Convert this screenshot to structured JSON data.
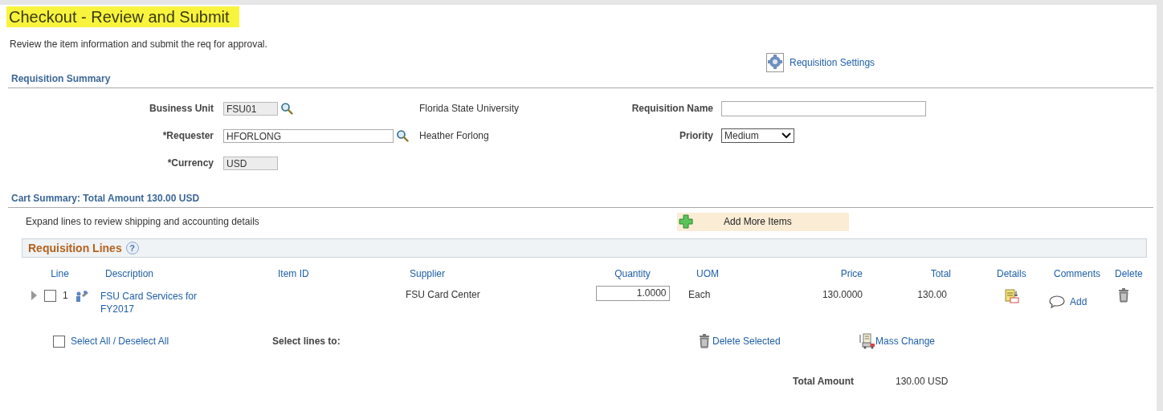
{
  "page": {
    "title": "Checkout - Review and Submit",
    "instructions": "Review the item information and submit the req for approval.",
    "settings_link": "Requisition Settings"
  },
  "requisition_summary": {
    "heading": "Requisition Summary",
    "fields": [
      {
        "label": "Business Unit",
        "kind": "lookup",
        "value": "FSU01",
        "disabled": true,
        "description": "Florida State University"
      },
      {
        "label": "*Requester",
        "kind": "lookup",
        "value": "HFORLONG",
        "disabled": false,
        "description": "Heather Forlong"
      },
      {
        "label": "*Currency",
        "kind": "text",
        "value": "USD",
        "disabled": true
      }
    ],
    "side_fields": [
      {
        "label": "Requisition Name",
        "kind": "text"
      },
      {
        "label": "Priority",
        "kind": "select",
        "value": "Medium"
      }
    ]
  },
  "cart_summary": {
    "heading": "Cart Summary: Total Amount 130.00 USD",
    "hint": "Expand lines to review shipping and accounting details",
    "add_button": "Add More Items"
  },
  "requisition_lines": {
    "title": "Requisition Lines",
    "help": "?",
    "columns": [
      "Line",
      "Description",
      "Item ID",
      "Supplier",
      "Quantity",
      "UOM",
      "Price",
      "Total",
      "Details",
      "Comments",
      "Delete"
    ],
    "rows": [
      {
        "expanded": false,
        "checked": false,
        "line": "1",
        "description": "FSU Card Services for FY2017",
        "supplier": "FSU Card Center",
        "quantity": "1.0000",
        "uom": "Each",
        "price": "130.0000",
        "total": "130.00",
        "comment_link": "Add"
      }
    ]
  },
  "actions": {
    "select_all": {
      "label": "Select All / Deselect All",
      "checked": false
    },
    "select_lines_label": "Select lines to:",
    "delete_selected": "Delete Selected",
    "mass_change": "Mass Change"
  },
  "totals": {
    "label": "Total Amount",
    "value": "130.00 USD"
  }
}
